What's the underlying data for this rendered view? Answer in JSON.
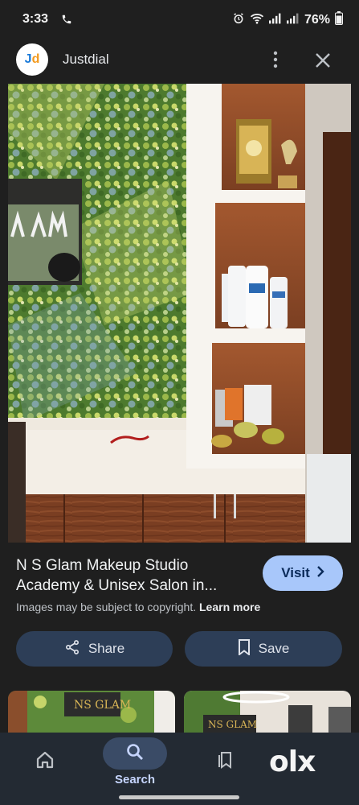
{
  "status": {
    "time": "3:33",
    "battery": "76%"
  },
  "header": {
    "app_name": "Justdial",
    "logo_j": "J",
    "logo_d": "d"
  },
  "result": {
    "title_line1": "N S Glam Makeup Studio",
    "title_line2": "Academy & Unisex Salon in...",
    "visit_label": "Visit",
    "copyright_text": "Images may be subject to copyright.",
    "learn_more": "Learn more"
  },
  "actions": {
    "share_label": "Share",
    "save_label": "Save"
  },
  "bottom_nav": {
    "search_label": "Search",
    "olx": "olx"
  },
  "icons": {
    "call": "call-icon",
    "alarm": "alarm-icon",
    "wifi": "wifi-icon",
    "signal": "signal-icon",
    "battery": "battery-icon",
    "more": "more-vert-icon",
    "close": "close-icon",
    "chevron": "chevron-right-icon",
    "share": "share-icon",
    "bookmark": "bookmark-icon",
    "home": "home-icon",
    "search": "search-icon",
    "collections": "collections-icon"
  },
  "colors": {
    "accent": "#a8c7fa",
    "action_bg": "#2d3e57",
    "background": "#1f1f1f",
    "nav_bg": "#232a33"
  }
}
